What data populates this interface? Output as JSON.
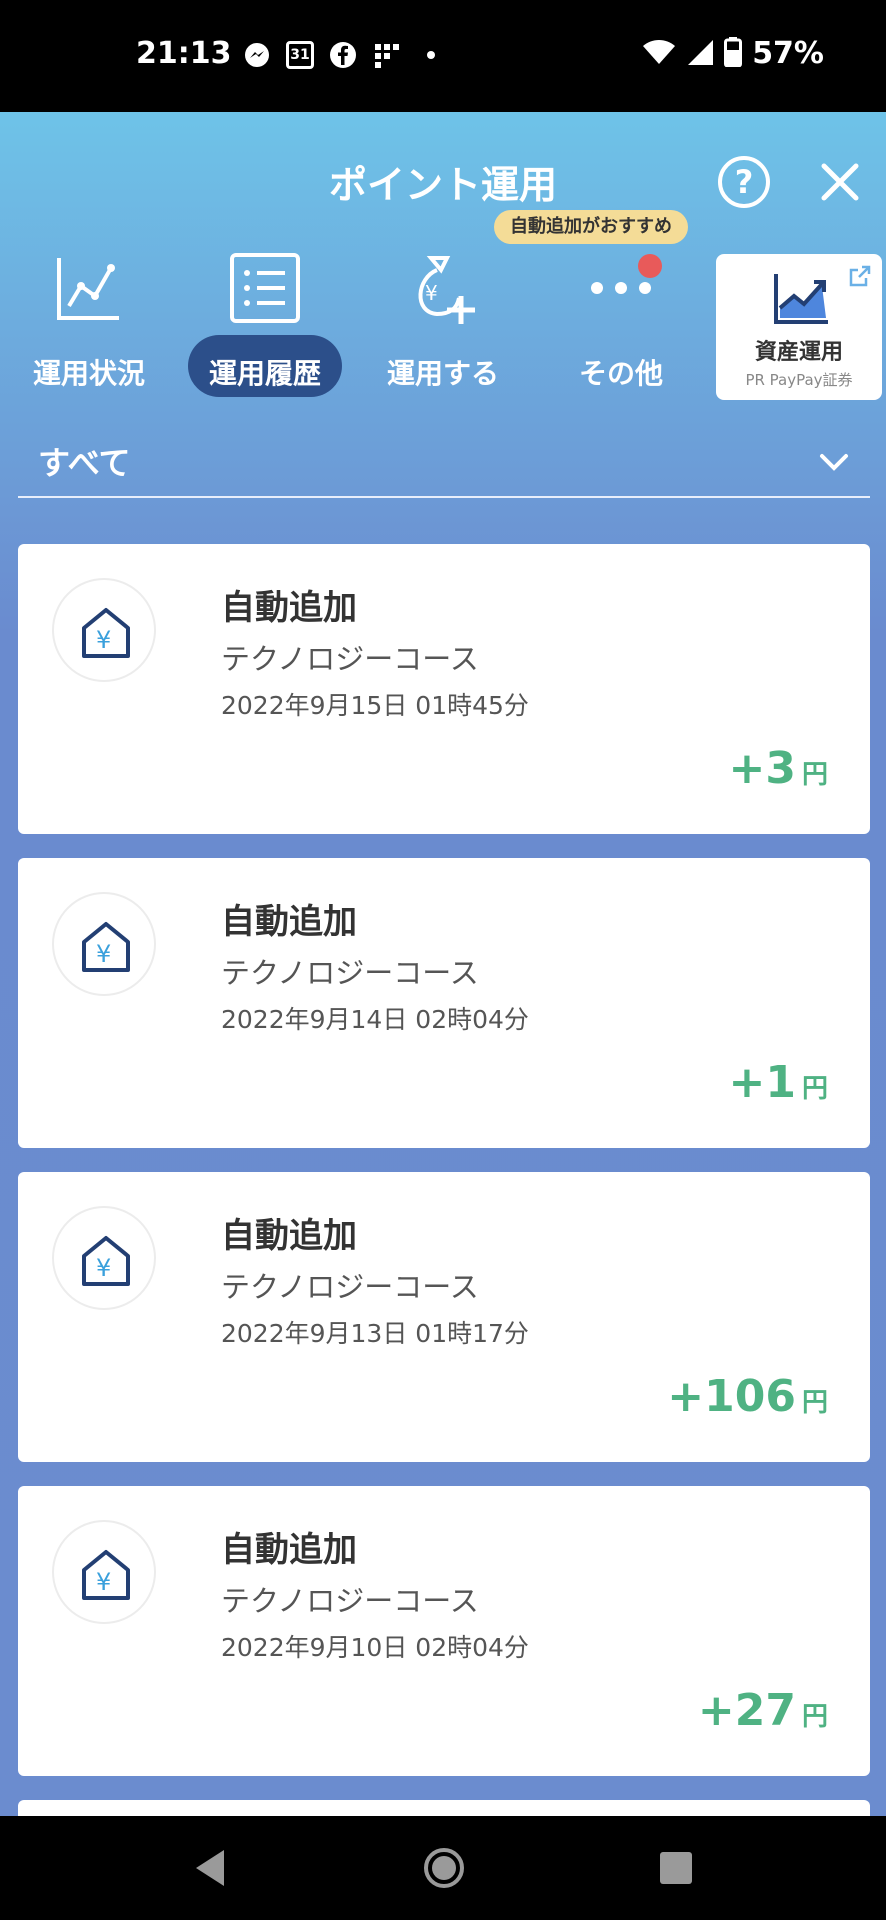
{
  "status_bar": {
    "time": "21:13",
    "calendar_day": "31",
    "battery": "57%",
    "left_icons": [
      "messenger-icon",
      "calendar-icon",
      "facebook-icon",
      "grid-app-icon",
      "dot-icon"
    ],
    "right_icons": [
      "wifi-icon",
      "signal-icon",
      "battery-icon"
    ]
  },
  "header": {
    "title": "ポイント運用",
    "help_label": "?",
    "tooltip": "自動追加がおすすめ"
  },
  "nav": {
    "items": [
      {
        "label": "運用状況",
        "icon": "chart-line-icon"
      },
      {
        "label": "運用履歴",
        "icon": "list-icon",
        "active": true
      },
      {
        "label": "運用する",
        "icon": "money-bag-plus-icon"
      },
      {
        "label": "その他",
        "icon": "more-dots-icon"
      }
    ],
    "asset_card": {
      "title": "資産運用",
      "subtitle": "PR PayPay証券",
      "icon": "trend-chart-icon"
    }
  },
  "filter": {
    "label": "すべて"
  },
  "history": [
    {
      "title": "自動追加",
      "course": "テクノロジーコース",
      "date": "2022年9月15日 01時45分",
      "amount": "+3",
      "unit": "円"
    },
    {
      "title": "自動追加",
      "course": "テクノロジーコース",
      "date": "2022年9月14日 02時04分",
      "amount": "+1",
      "unit": "円"
    },
    {
      "title": "自動追加",
      "course": "テクノロジーコース",
      "date": "2022年9月13日 01時17分",
      "amount": "+106",
      "unit": "円"
    },
    {
      "title": "自動追加",
      "course": "テクノロジーコース",
      "date": "2022年9月10日 02時04分",
      "amount": "+27",
      "unit": "円"
    }
  ],
  "colors": {
    "accent_dark": "#2c4f8a",
    "positive": "#4fb283",
    "tooltip_bg": "#f4dc97",
    "notification": "#e85a5a"
  }
}
